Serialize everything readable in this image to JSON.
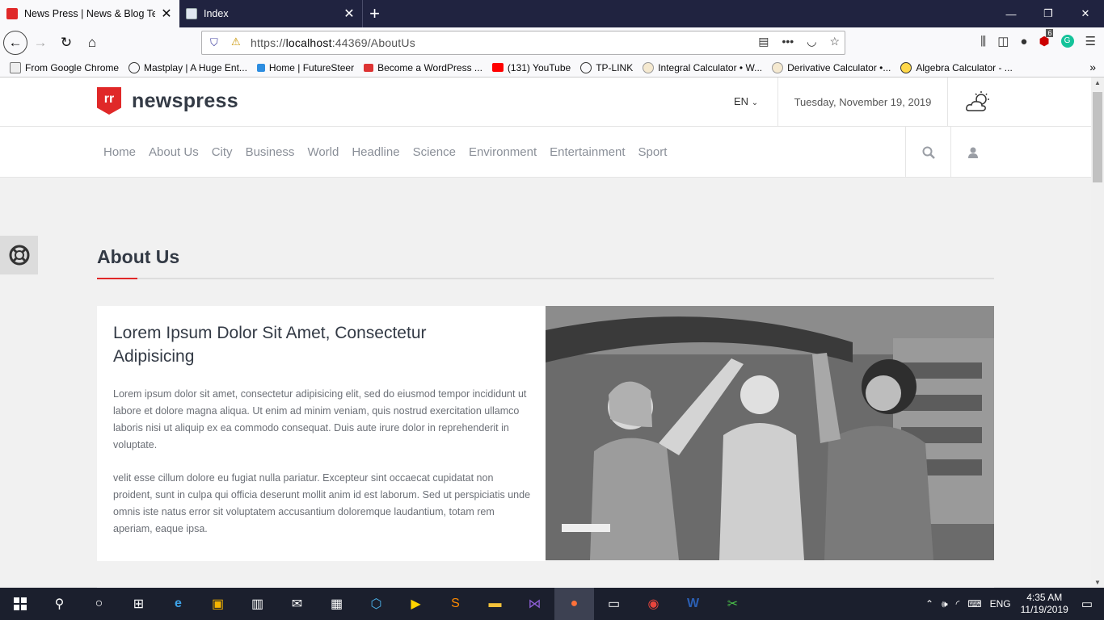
{
  "browser": {
    "tabs": [
      {
        "title": "News Press | News & Blog Temp",
        "active": true
      },
      {
        "title": "Index",
        "active": false
      }
    ],
    "url": {
      "prefix": "https://",
      "host": "localhost",
      "rest": ":44369/AboutUs"
    },
    "bookmarks": [
      "From Google Chrome",
      "Mastplay | A Huge Ent...",
      "Home | FutureSteer",
      "Become a WordPress ...",
      "(131) YouTube",
      "TP-LINK",
      "Integral Calculator • W...",
      "Derivative Calculator •...",
      "Algebra Calculator - ..."
    ],
    "badge_count": "6"
  },
  "site": {
    "brand": "newspress",
    "logo_glyph": "rr",
    "lang": "EN",
    "date": "Tuesday, November 19, 2019",
    "menu": [
      "Home",
      "About Us",
      "City",
      "Business",
      "World",
      "Headline",
      "Science",
      "Environment",
      "Entertainment",
      "Sport"
    ]
  },
  "main": {
    "section_title": "About Us",
    "heading": "Lorem Ipsum Dolor Sit Amet, Consectetur Adipisicing",
    "para1": "Lorem ipsum dolor sit amet, consectetur adipisicing elit, sed do eiusmod tempor incididunt ut labore et dolore magna aliqua. Ut enim ad minim veniam, quis nostrud exercitation ullamco laboris nisi ut aliquip ex ea commodo consequat. Duis aute irure dolor in reprehenderit in voluptate.",
    "para2": "velit esse cillum dolore eu fugiat nulla pariatur. Excepteur sint occaecat cupidatat non proident, sunt in culpa qui officia deserunt mollit anim id est laborum. Sed ut perspiciatis unde omnis iste natus error sit voluptatem accusantium doloremque laudantium, totam rem aperiam, eaque ipsa."
  },
  "taskbar": {
    "lang": "ENG",
    "time": "4:35 AM",
    "date": "11/19/2019"
  },
  "colors": {
    "accent": "#e02828",
    "tabbar": "#202340",
    "taskbar": "#1b1f2d"
  }
}
